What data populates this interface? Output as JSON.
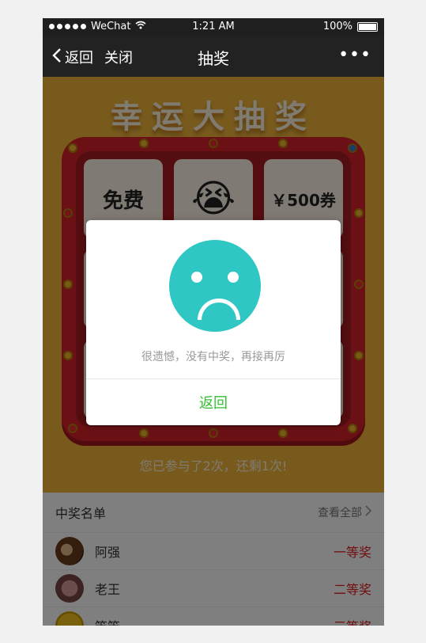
{
  "status_bar": {
    "carrier": "WeChat",
    "time": "1:21 AM",
    "battery": "100%"
  },
  "nav": {
    "back_label": "返回",
    "close_label": "关闭",
    "title": "抽奖",
    "more_icon": "more-dots-icon"
  },
  "game": {
    "title": "幸运大抽奖",
    "cells": [
      {
        "label": "免费"
      },
      {
        "label": "😭"
      },
      {
        "label": "￥500券"
      }
    ],
    "chances_text": "您已参与了2次，还剩1次!"
  },
  "winners": {
    "title": "中奖名单",
    "view_all": "查看全部",
    "rows": [
      {
        "name": "阿强",
        "prize": "一等奖"
      },
      {
        "name": "老王",
        "prize": "二等奖"
      },
      {
        "name": "笨笨",
        "prize": "三等奖"
      }
    ]
  },
  "modal": {
    "icon": "sad-face-icon",
    "message": "很遗憾，没有中奖，再接再厉",
    "action_label": "返回"
  },
  "colors": {
    "game_bg": "#f1b53b",
    "board_red": "#d7232b",
    "modal_icon": "#2ec7c3",
    "action_green": "#32c032",
    "prize_red": "#e11b1b"
  }
}
